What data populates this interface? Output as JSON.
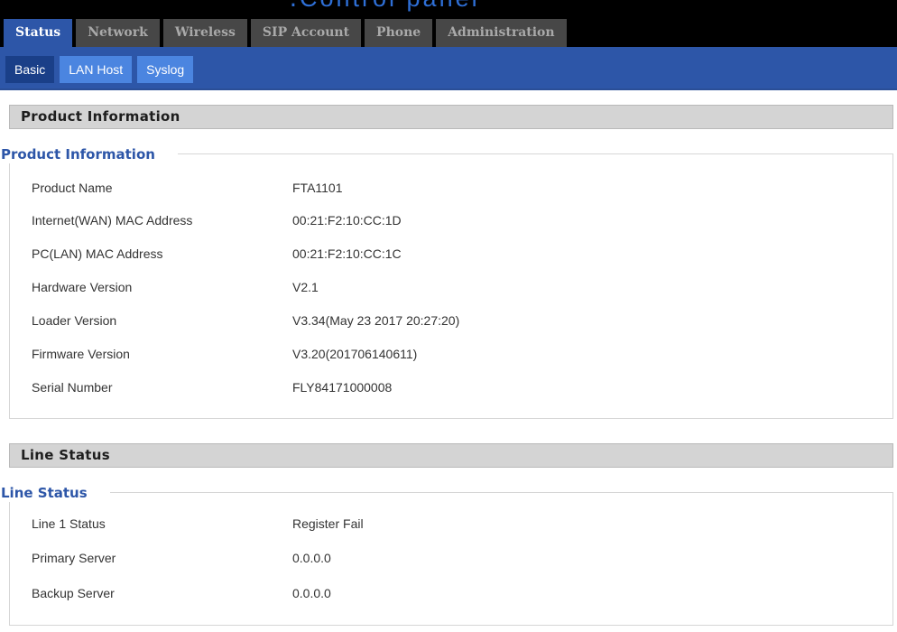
{
  "nav": {
    "main_tabs": [
      {
        "label": "Status",
        "active": true
      },
      {
        "label": "Network",
        "active": false
      },
      {
        "label": "Wireless",
        "active": false
      },
      {
        "label": "SIP Account",
        "active": false
      },
      {
        "label": "Phone",
        "active": false
      },
      {
        "label": "Administration",
        "active": false
      }
    ],
    "sub_tabs": [
      {
        "label": "Basic",
        "active": true
      },
      {
        "label": "LAN Host",
        "active": false
      },
      {
        "label": "Syslog",
        "active": false
      }
    ]
  },
  "product_section": {
    "header": "Product Information",
    "legend": "Product Information",
    "rows": [
      {
        "label": "Product Name",
        "value": "FTA1101"
      },
      {
        "label": "Internet(WAN) MAC Address",
        "value": "00:21:F2:10:CC:1D"
      },
      {
        "label": "PC(LAN) MAC Address",
        "value": "00:21:F2:10:CC:1C"
      },
      {
        "label": "Hardware Version",
        "value": "V2.1"
      },
      {
        "label": "Loader Version",
        "value": "V3.34(May 23 2017 20:27:20)"
      },
      {
        "label": "Firmware Version",
        "value": "V3.20(201706140611)"
      },
      {
        "label": "Serial Number",
        "value": "FLY84171000008"
      }
    ]
  },
  "line_section": {
    "header": "Line Status",
    "legend": "Line Status",
    "rows": [
      {
        "label": "Line 1 Status",
        "value": "Register Fail"
      },
      {
        "label": "Primary Server",
        "value": "0.0.0.0"
      },
      {
        "label": "Backup Server",
        "value": "0.0.0.0"
      }
    ]
  },
  "colors": {
    "nav_blue": "#2d56a8",
    "sub_tab_blue": "#4b85e0",
    "legend_blue": "#2d56a8",
    "tab_dark": "#474747"
  }
}
